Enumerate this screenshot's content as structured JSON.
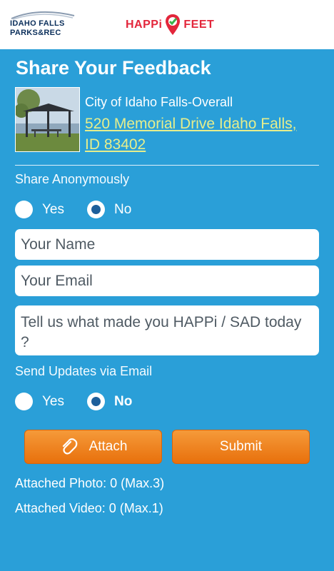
{
  "header": {
    "left_logo": {
      "line1": "IDAHO FALLS",
      "line2": "PARKS&REC"
    },
    "right_logo": {
      "part1": "HAPPi",
      "part2": "FEET"
    }
  },
  "title": "Share Your Feedback",
  "place": {
    "name": "City of Idaho Falls-Overall",
    "address": "520 Memorial Drive Idaho Falls, ID  83402"
  },
  "anonymous": {
    "label": "Share Anonymously",
    "options": [
      "Yes",
      "No"
    ],
    "selected": "No"
  },
  "form": {
    "name_placeholder": "Your Name",
    "email_placeholder": "Your Email",
    "message_placeholder": "Tell us what made you HAPPi / SAD today ?"
  },
  "updates": {
    "label": "Send Updates via Email",
    "options": [
      "Yes",
      "No"
    ],
    "selected": "No"
  },
  "buttons": {
    "attach": "Attach",
    "submit": "Submit"
  },
  "attachments": {
    "photo": "Attached Photo: 0 (Max.3)",
    "video": "Attached Video: 0 (Max.1)"
  },
  "colors": {
    "background": "#2a9fd8",
    "button": "#f08a24",
    "link": "#e6ee8c",
    "brand_red": "#e3263b"
  }
}
